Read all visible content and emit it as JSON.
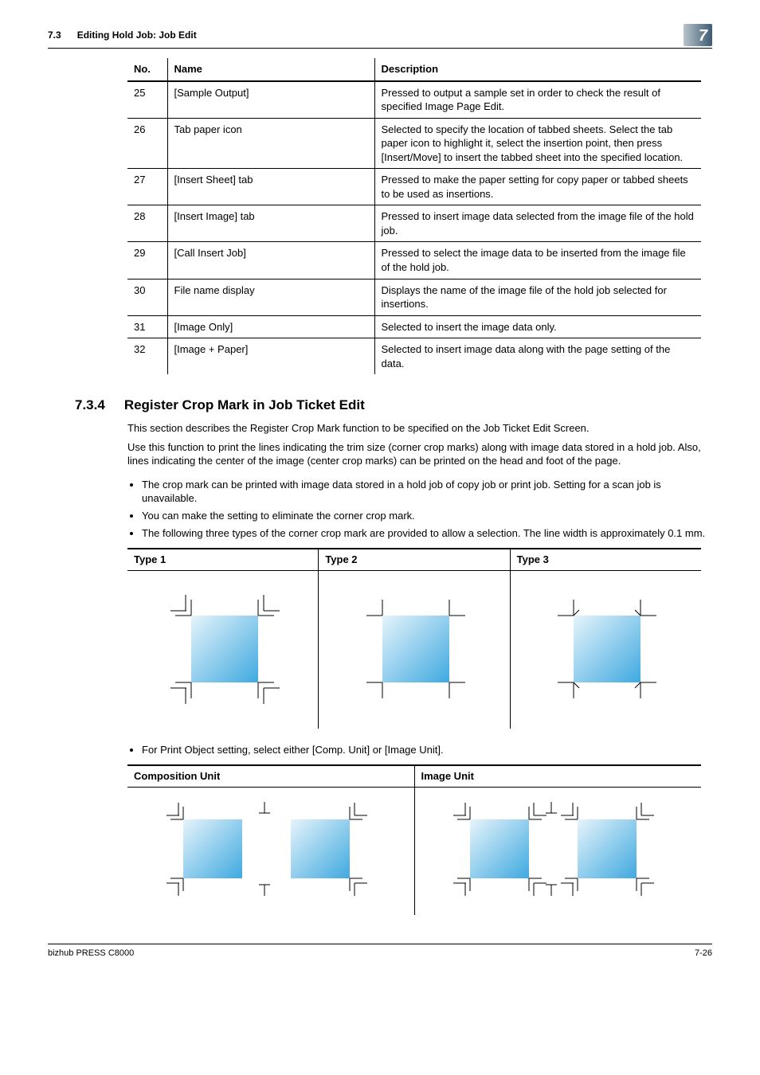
{
  "header": {
    "section_no": "7.3",
    "section_title": "Editing Hold Job: Job Edit",
    "chapter": "7"
  },
  "table": {
    "headers": {
      "no": "No.",
      "name": "Name",
      "desc": "Description"
    },
    "rows": [
      {
        "no": "25",
        "name": "[Sample Output]",
        "desc": "Pressed to output a sample set in order to check the result of specified Image Page Edit."
      },
      {
        "no": "26",
        "name": "Tab paper icon",
        "desc": "Selected to specify the location of tabbed sheets. Select the tab paper icon to highlight it, select the insertion point, then press [Insert/Move] to insert the tabbed sheet into the specified location."
      },
      {
        "no": "27",
        "name": "[Insert Sheet] tab",
        "desc": "Pressed to make the paper setting for copy paper or tabbed sheets to be used as insertions."
      },
      {
        "no": "28",
        "name": "[Insert Image] tab",
        "desc": "Pressed to insert image data selected from the image file of the hold job."
      },
      {
        "no": "29",
        "name": "[Call Insert Job]",
        "desc": "Pressed to select the image data to be inserted from the image file of the hold job."
      },
      {
        "no": "30",
        "name": "File name display",
        "desc": "Displays the name of the image file of the hold job selected for insertions."
      },
      {
        "no": "31",
        "name": "[Image Only]",
        "desc": "Selected to insert the image data only."
      },
      {
        "no": "32",
        "name": "[Image + Paper]",
        "desc": "Selected to insert image data along with the page setting of the data."
      }
    ]
  },
  "section": {
    "num": "7.3.4",
    "title": "Register Crop Mark in Job Ticket Edit",
    "p1": "This section describes the Register Crop Mark function to be specified on the Job Ticket Edit Screen.",
    "p2": "Use this function to print the lines indicating the trim size (corner crop marks) along with image data stored in a hold job. Also, lines indicating the center of the image (center crop marks) can be printed on the head and foot of the page.",
    "bullets1": [
      "The crop mark can be printed with image data stored in a hold job of copy job or print job. Setting for a scan job is unavailable.",
      "You can make the setting to eliminate the corner crop mark.",
      "The following three types of the corner crop mark are provided to allow a selection. The line width is approximately 0.1 mm."
    ],
    "types": {
      "t1": "Type 1",
      "t2": "Type 2",
      "t3": "Type 3"
    },
    "bullets2": "For Print Object setting, select either [Comp. Unit] or [Image Unit].",
    "comp": {
      "h1": "Composition Unit",
      "h2": "Image Unit"
    }
  },
  "footer": {
    "left": "bizhub PRESS C8000",
    "right": "7-26"
  },
  "chart_data": [
    {
      "type": "table",
      "title": "Corner crop mark types",
      "categories": [
        "Type 1",
        "Type 2",
        "Type 3"
      ],
      "values": [
        "paired right-angle marks at each corner (two offset L marks)",
        "single right-angle L mark at each corner",
        "right-angle mark with short inward tick at each corner"
      ]
    },
    {
      "type": "table",
      "title": "Print Object setting",
      "categories": [
        "Composition Unit",
        "Image Unit"
      ],
      "values": [
        "crop/center marks placed once around the full composed sheet containing two images",
        "crop/center marks placed around each individual image on the sheet"
      ]
    }
  ]
}
